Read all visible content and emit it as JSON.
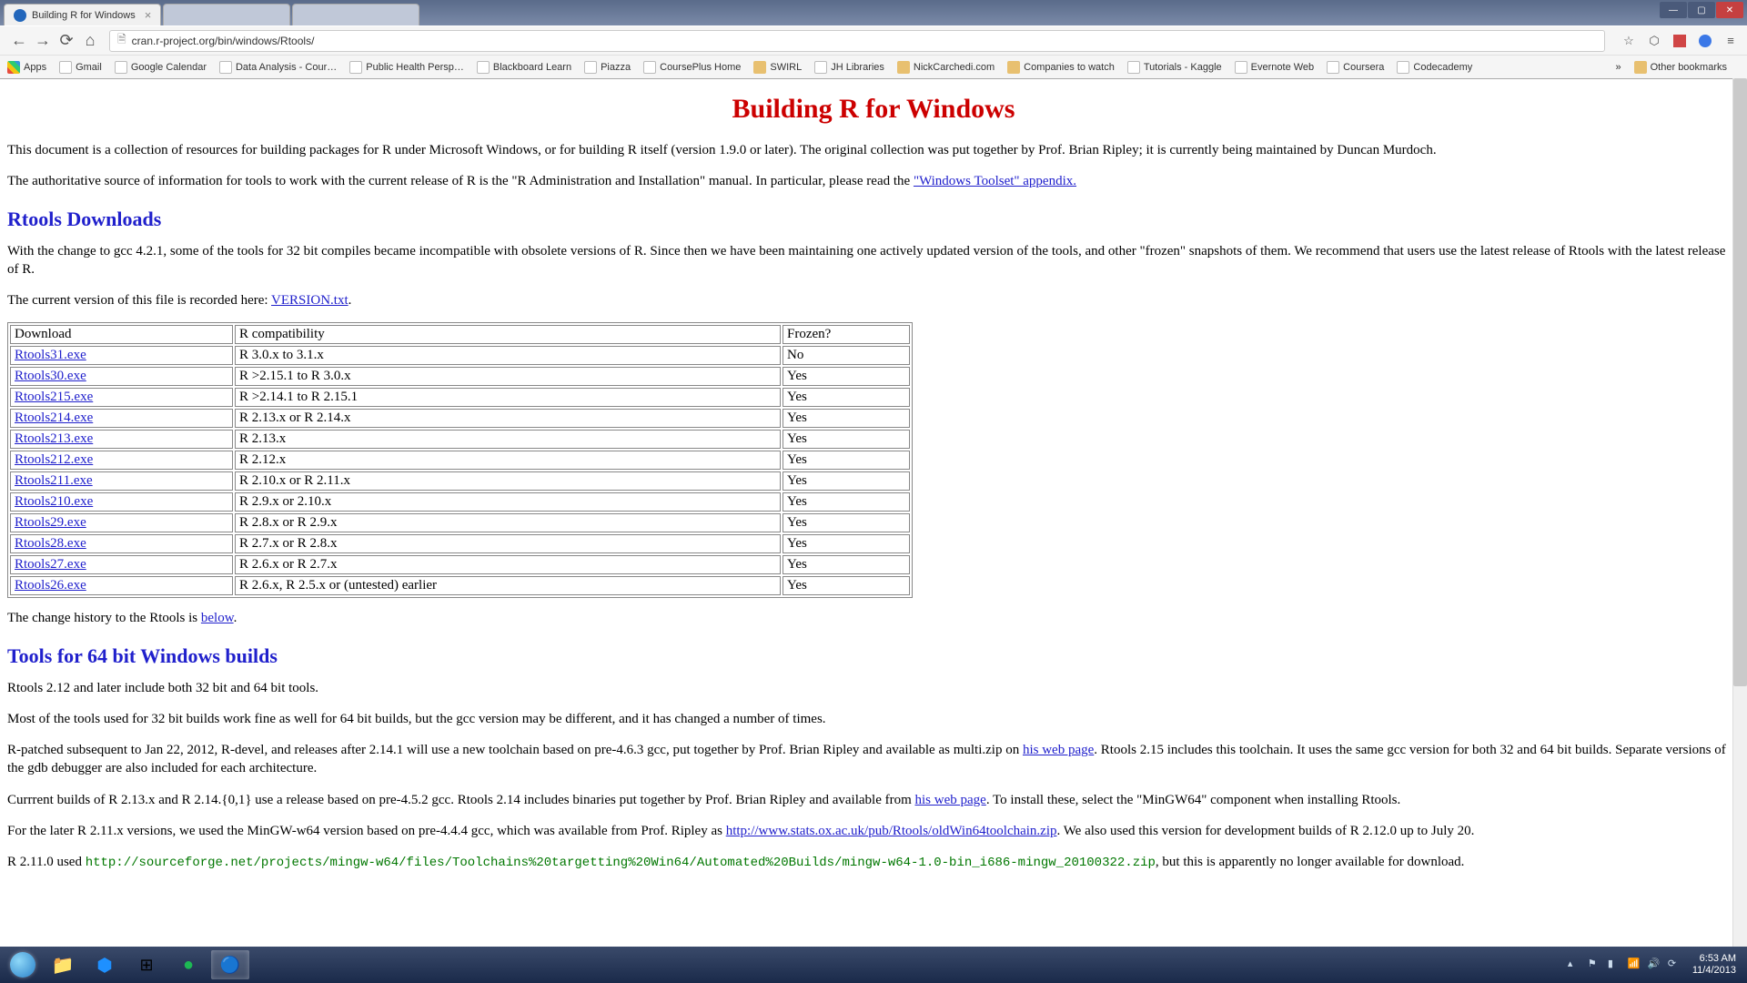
{
  "window": {
    "active_tab_title": "Building R for Windows",
    "url": "cran.r-project.org/bin/windows/Rtools/"
  },
  "bookmarks": [
    {
      "label": "Apps",
      "cls": "apps"
    },
    {
      "label": "Gmail",
      "cls": "page"
    },
    {
      "label": "Google Calendar",
      "cls": "page"
    },
    {
      "label": "Data Analysis - Cour…",
      "cls": "page"
    },
    {
      "label": "Public Health Persp…",
      "cls": "page"
    },
    {
      "label": "Blackboard Learn",
      "cls": "page"
    },
    {
      "label": "Piazza",
      "cls": "page"
    },
    {
      "label": "CoursePlus Home",
      "cls": "page"
    },
    {
      "label": "SWIRL",
      "cls": "folder"
    },
    {
      "label": "JH Libraries",
      "cls": "page"
    },
    {
      "label": "NickCarchedi.com",
      "cls": "folder"
    },
    {
      "label": "Companies to watch",
      "cls": "folder"
    },
    {
      "label": "Tutorials - Kaggle",
      "cls": "page"
    },
    {
      "label": "Evernote Web",
      "cls": "page"
    },
    {
      "label": "Coursera",
      "cls": "page"
    },
    {
      "label": "Codecademy",
      "cls": "page"
    }
  ],
  "other_bookmarks": "Other bookmarks",
  "page": {
    "title": "Building R for Windows",
    "intro": "This document is a collection of resources for building packages for R under Microsoft Windows, or for building R itself (version 1.9.0 or later). The original collection was put together by Prof. Brian Ripley; it is currently being maintained by Duncan Murdoch.",
    "auth_text_pre": "The authoritative source of information for tools to work with the current release of R is the \"R Administration and Installation\" manual. In particular, please read the ",
    "auth_link": "\"Windows Toolset\" appendix.",
    "h_downloads": "Rtools Downloads",
    "downloads_para": "With the change to gcc 4.2.1, some of the tools for 32 bit compiles became incompatible with obsolete versions of R. Since then we have been maintaining one actively updated version of the tools, and other \"frozen\" snapshots of them. We recommend that users use the latest release of Rtools with the latest release of R.",
    "current_ver_pre": "The current version of this file is recorded here: ",
    "current_ver_link": "VERSION.txt",
    "table_headers": {
      "dl": "Download",
      "compat": "R compatibility",
      "frozen": "Frozen?"
    },
    "table_rows": [
      {
        "dl": "Rtools31.exe",
        "compat": "R 3.0.x to 3.1.x",
        "frozen": "No"
      },
      {
        "dl": "Rtools30.exe",
        "compat": "R >2.15.1 to R 3.0.x",
        "frozen": "Yes"
      },
      {
        "dl": "Rtools215.exe",
        "compat": "R >2.14.1 to R 2.15.1",
        "frozen": "Yes"
      },
      {
        "dl": "Rtools214.exe",
        "compat": "R 2.13.x or R 2.14.x",
        "frozen": "Yes"
      },
      {
        "dl": "Rtools213.exe",
        "compat": "R 2.13.x",
        "frozen": "Yes"
      },
      {
        "dl": "Rtools212.exe",
        "compat": "R 2.12.x",
        "frozen": "Yes"
      },
      {
        "dl": "Rtools211.exe",
        "compat": "R 2.10.x or R 2.11.x",
        "frozen": "Yes"
      },
      {
        "dl": "Rtools210.exe",
        "compat": "R 2.9.x or 2.10.x",
        "frozen": "Yes"
      },
      {
        "dl": "Rtools29.exe",
        "compat": "R 2.8.x or R 2.9.x",
        "frozen": "Yes"
      },
      {
        "dl": "Rtools28.exe",
        "compat": "R 2.7.x or R 2.8.x",
        "frozen": "Yes"
      },
      {
        "dl": "Rtools27.exe",
        "compat": "R 2.6.x or R 2.7.x",
        "frozen": "Yes"
      },
      {
        "dl": "Rtools26.exe",
        "compat": "R 2.6.x, R 2.5.x or (untested) earlier",
        "frozen": "Yes"
      }
    ],
    "change_hist_pre": "The change history to the Rtools is ",
    "change_hist_link": "below",
    "h_64bit": "Tools for 64 bit Windows builds",
    "p64_1": "Rtools 2.12 and later include both 32 bit and 64 bit tools.",
    "p64_2": "Most of the tools used for 32 bit builds work fine as well for 64 bit builds, but the gcc version may be different, and it has changed a number of times.",
    "p64_3a": "R-patched subsequent to Jan 22, 2012, R-devel, and releases after 2.14.1 will use a new toolchain based on pre-4.6.3 gcc, put together by Prof. Brian Ripley and available as multi.zip on ",
    "p64_3link": "his web page",
    "p64_3b": ". Rtools 2.15 includes this toolchain. It uses the same gcc version for both 32 and 64 bit builds. Separate versions of the gdb debugger are also included for each architecture.",
    "p64_4a": "Currrent builds of R 2.13.x and R 2.14.{0,1} use a release based on pre-4.5.2 gcc. Rtools 2.14 includes binaries put together by Prof. Brian Ripley and available from ",
    "p64_4link": "his web page",
    "p64_4b": ". To install these, select the \"MinGW64\" component when installing Rtools.",
    "p64_5a": "For the later R 2.11.x versions, we used the MinGW-w64 version based on pre-4.4.4 gcc, which was available from Prof. Ripley as ",
    "p64_5link": "http://www.stats.ox.ac.uk/pub/Rtools/oldWin64toolchain.zip",
    "p64_5b": ". We also used this version for development builds of R 2.12.0 up to July 20.",
    "p64_6a": "R 2.11.0 used ",
    "p64_6code": "http://sourceforge.net/projects/mingw-w64/files/Toolchains%20targetting%20Win64/Automated%20Builds/mingw-w64-1.0-bin_i686-mingw_20100322.zip",
    "p64_6b": ", but this is apparently no longer available for download."
  },
  "taskbar": {
    "time": "6:53 AM",
    "date": "11/4/2013"
  }
}
